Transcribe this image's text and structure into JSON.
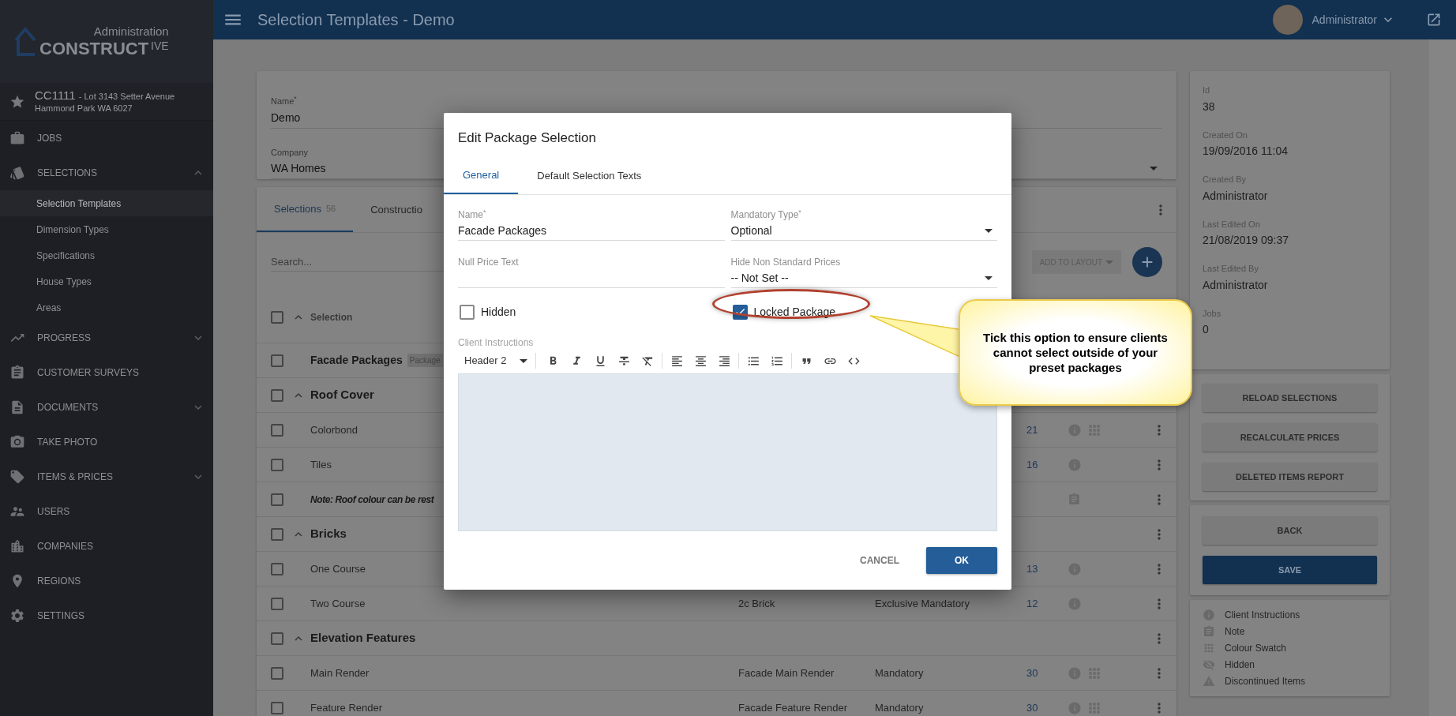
{
  "sidebar": {
    "logo": {
      "caption": "Administration",
      "wordmark": "CONSTRUCT",
      "suffix": "IVE"
    },
    "job": {
      "code": "CC1111",
      "address_line_1": "- Lot 3143 Setter Avenue",
      "address_line_2": "Hammond Park WA 6027"
    },
    "items": [
      {
        "label": "JOBS"
      },
      {
        "label": "SELECTIONS",
        "expanded": true,
        "children": [
          {
            "label": "Selection Templates",
            "selected": true
          },
          {
            "label": "Dimension Types",
            "selected": false
          },
          {
            "label": "Specifications",
            "selected": false
          },
          {
            "label": "House Types",
            "selected": false
          },
          {
            "label": "Areas",
            "selected": false
          }
        ]
      },
      {
        "label": "PROGRESS",
        "expanded": false
      },
      {
        "label": "CUSTOMER SURVEYS"
      },
      {
        "label": "DOCUMENTS",
        "expanded": false
      },
      {
        "label": "TAKE PHOTO"
      },
      {
        "label": "ITEMS & PRICES",
        "expanded": false
      },
      {
        "label": "USERS"
      },
      {
        "label": "COMPANIES"
      },
      {
        "label": "REGIONS"
      },
      {
        "label": "SETTINGS"
      }
    ]
  },
  "header": {
    "title": "Selection Templates - Demo",
    "user": "Administrator"
  },
  "template": {
    "fields": [
      {
        "label": "Name$^{*}$",
        "value": "Demo",
        "kind": "text"
      },
      {
        "label": "Company",
        "value": "WA Homes",
        "kind": "select"
      }
    ]
  },
  "selections": {
    "tabs": [
      {
        "label": "Selections",
        "count": "56",
        "selected": true
      },
      {
        "label": "Constructio",
        "selected": false
      }
    ],
    "search": {
      "placeholder": "Search..."
    },
    "toolbar": {
      "layout_button": "ADD TO LAYOUT"
    },
    "header": {
      "label": "Selection",
      "checked": false
    },
    "rows": [
      {
        "kind": "package",
        "name": "Facade Packages",
        "badge": "Package",
        "checked": false
      },
      {
        "kind": "group",
        "name": "Roof Cover",
        "expanded": true,
        "checked": false
      },
      {
        "kind": "item",
        "name": "Colorbond",
        "col4": "21",
        "has_instructions": true,
        "has_swatch": true,
        "checked": false
      },
      {
        "kind": "item",
        "name": "Tiles",
        "col4": "16",
        "has_instructions": true,
        "checked": false
      },
      {
        "kind": "note",
        "name": "Note: Roof colour can be rest",
        "has_note": true,
        "checked": false
      },
      {
        "kind": "group",
        "name": "Bricks",
        "expanded": true,
        "checked": false
      },
      {
        "kind": "item",
        "name": "One Course",
        "col4": "13",
        "has_instructions": true,
        "checked": false
      },
      {
        "kind": "item",
        "name": "Two Course",
        "col2": "2c Brick",
        "col3": "Exclusive Mandatory",
        "col4": "12",
        "has_instructions": true,
        "checked": false
      },
      {
        "kind": "group",
        "name": "Elevation Features",
        "expanded": true,
        "checked": false
      },
      {
        "kind": "item",
        "name": "Main Render",
        "col2": "Facade Main Render",
        "col3": "Mandatory",
        "col4": "30",
        "has_instructions": true,
        "has_swatch": true,
        "checked": false
      },
      {
        "kind": "item",
        "name": "Feature Render",
        "col2": "Facade Feature Render",
        "col3": "Mandatory",
        "col4": "30",
        "has_instructions": true,
        "has_swatch": true,
        "checked": false
      }
    ]
  },
  "info": [
    {
      "label": "Id",
      "value": "38"
    },
    {
      "label": "Created On",
      "value": "19/09/2016 11:04"
    },
    {
      "label": "Created By",
      "value": "Administrator"
    },
    {
      "label": "Last Edited On",
      "value": "21/08/2019 09:37"
    },
    {
      "label": "Last Edited By",
      "value": "Administrator"
    },
    {
      "label": "Jobs",
      "value": "0"
    }
  ],
  "actions": [
    "RELOAD SELECTIONS",
    "RECALCULATE PRICES",
    "DELETED ITEMS REPORT"
  ],
  "nav_buttons": [
    {
      "label": "BACK",
      "kind": "default"
    },
    {
      "label": "SAVE",
      "kind": "primary"
    }
  ],
  "legend": [
    "Client Instructions",
    "Note",
    "Colour Swatch",
    "Hidden",
    "Discontinued Items"
  ],
  "dialog": {
    "title": "Edit Package Selection",
    "tabs": [
      {
        "label": "General",
        "selected": true
      },
      {
        "label": "Default Selection Texts",
        "selected": false
      }
    ],
    "fields": [
      {
        "label": "Name$^{*}$",
        "value": "Facade Packages",
        "kind": "text"
      },
      {
        "label": "Mandatory Type$^{*}$",
        "value": "Optional",
        "kind": "select"
      },
      {
        "label": "Null Price Text",
        "kind": "text"
      },
      {
        "label": "Hide Non Standard Prices",
        "value": "-- Not Set --",
        "kind": "select"
      }
    ],
    "checkboxes": [
      {
        "label": "Hidden",
        "checked": false,
        "highlighted": false
      },
      {
        "label": "Locked Package",
        "checked": true,
        "highlighted": true
      }
    ],
    "editor": {
      "label": "Client Instructions",
      "heading_style": "Header 2"
    },
    "buttons": [
      {
        "label": "CANCEL",
        "kind": "flat"
      },
      {
        "label": "OK",
        "kind": "primary"
      }
    ]
  },
  "callout": {
    "text": "Tick this option to ensure clients cannot select outside of your preset packages"
  }
}
